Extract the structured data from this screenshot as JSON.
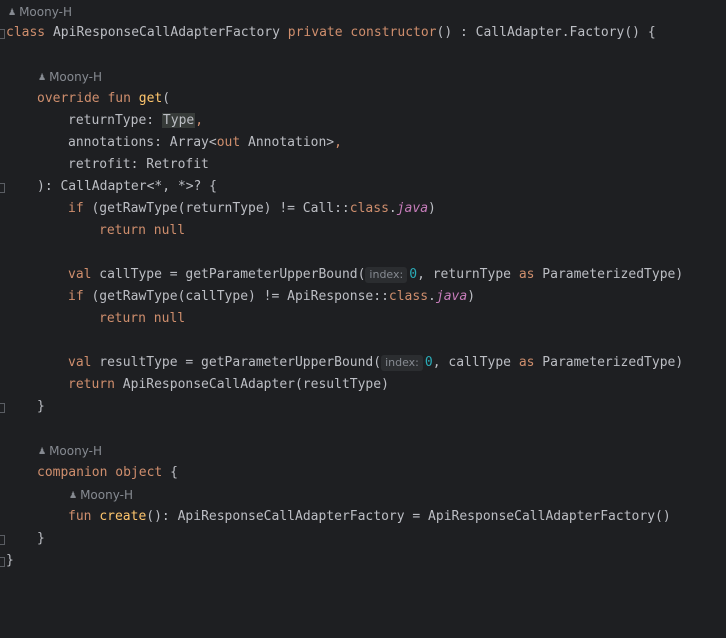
{
  "editor": {
    "author": "Moony-H",
    "author_icon": "person-icon",
    "accent_colors": {
      "keyword": "#cf8e6d",
      "function": "#56a8f5",
      "number": "#2aacb8",
      "italic_member": "#c77dbb",
      "hint_text": "#868a91"
    },
    "lines": {
      "l1_class": "class",
      "l1_name": " ApiResponseCallAdapterFactory ",
      "l1_private": "private",
      "l1_sp": " ",
      "l1_constructor": "constructor",
      "l1_rest": "() : CallAdapter.Factory() {",
      "l2_override": "override",
      "l2_sp": " ",
      "l2_fun": "fun",
      "l2_sp2": " ",
      "l2_get": "get",
      "l2_paren": "(",
      "l3_name": "returnType: ",
      "l3_type": "Type",
      "l3_comma": ",",
      "l4_a": "annotations: Array<",
      "l4_out": "out",
      "l4_b": " Annotation>",
      "l4_comma": ",",
      "l5": "retrofit: Retrofit",
      "l6": "): CallAdapter<*, *>? {",
      "l7_if": "if",
      "l7_a": " (getRawType(returnType) != Call::",
      "l7_class": "class",
      "l7_dot": ".",
      "l7_java": "java",
      "l7_close": ")",
      "l8_return": "return",
      "l8_sp": " ",
      "l8_null": "null",
      "l9_val": "val",
      "l9_a": " callType = getParameterUpperBound(",
      "l9_hint": "index:",
      "l9_num": "0",
      "l9_b": ", returnType ",
      "l9_as": "as",
      "l9_c": " ParameterizedType)",
      "l10_if": "if",
      "l10_a": " (getRawType(callType) != ApiResponse::",
      "l10_class": "class",
      "l10_dot": ".",
      "l10_java": "java",
      "l10_close": ")",
      "l11_return": "return",
      "l11_sp": " ",
      "l11_null": "null",
      "l12_val": "val",
      "l12_a": " resultType = getParameterUpperBound(",
      "l12_hint": "index:",
      "l12_num": "0",
      "l12_b": ", callType ",
      "l12_as": "as",
      "l12_c": " ParameterizedType)",
      "l13_return": "return",
      "l13_a": " ApiResponseCallAdapter(resultType)",
      "l14": "}",
      "l15_companion": "companion",
      "l15_sp": " ",
      "l15_object": "object",
      "l15_brace": " {",
      "l16_fun": "fun",
      "l16_sp": " ",
      "l16_create": "create",
      "l16_rest": "(): ApiResponseCallAdapterFactory = ApiResponseCallAdapterFactory()",
      "l17": "}",
      "l18": "}"
    }
  }
}
